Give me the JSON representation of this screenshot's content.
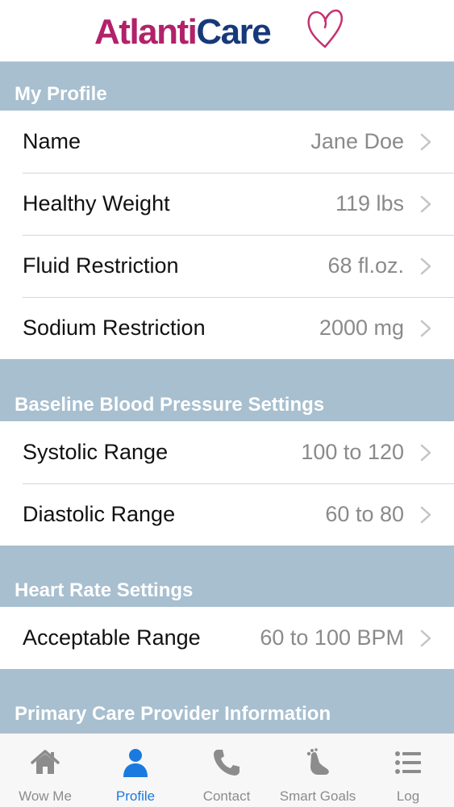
{
  "header": {
    "logo_part1": "At",
    "logo_part2": "lanti",
    "logo_part3": "Care"
  },
  "colors": {
    "section_bg": "#a7bfcf",
    "active_tab": "#1a7ae0",
    "logo_magenta": "#b1226a",
    "logo_navy": "#17397a"
  },
  "sections": [
    {
      "title": "My Profile",
      "rows": [
        {
          "label": "Name",
          "value": "Jane Doe"
        },
        {
          "label": "Healthy Weight",
          "value": "119 lbs"
        },
        {
          "label": "Fluid Restriction",
          "value": "68 fl.oz."
        },
        {
          "label": "Sodium Restriction",
          "value": "2000 mg"
        }
      ]
    },
    {
      "title": "Baseline Blood Pressure Settings",
      "rows": [
        {
          "label": "Systolic Range",
          "value": "100 to 120"
        },
        {
          "label": "Diastolic Range",
          "value": "60 to 80"
        }
      ]
    },
    {
      "title": "Heart Rate Settings",
      "rows": [
        {
          "label": "Acceptable Range",
          "value": "60 to 100 BPM"
        }
      ]
    },
    {
      "title": "Primary Care Provider Information",
      "rows": []
    }
  ],
  "tabs": [
    {
      "label": "Wow Me",
      "icon": "home-icon",
      "active": false
    },
    {
      "label": "Profile",
      "icon": "person-icon",
      "active": true
    },
    {
      "label": "Contact",
      "icon": "phone-icon",
      "active": false
    },
    {
      "label": "Smart Goals",
      "icon": "footprint-icon",
      "active": false
    },
    {
      "label": "Log",
      "icon": "list-icon",
      "active": false
    }
  ]
}
